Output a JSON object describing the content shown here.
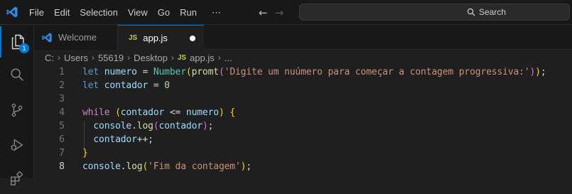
{
  "menu": [
    "File",
    "Edit",
    "Selection",
    "View",
    "Go",
    "Run",
    "⋯"
  ],
  "search": {
    "label": "Search"
  },
  "activity": {
    "explorer_badge": "1"
  },
  "tabs": [
    {
      "label": "Welcome",
      "icon": "vscode-icon"
    },
    {
      "label": "app.js",
      "icon": "JS",
      "dirty": true
    }
  ],
  "breadcrumb": {
    "items": [
      "C:",
      "Users",
      "55619",
      "Desktop"
    ],
    "file_icon": "JS",
    "file": "app.js",
    "symbol": "..."
  },
  "editor": {
    "line_numbers": [
      "1",
      "2",
      "3",
      "4",
      "5",
      "6",
      "7",
      "8"
    ],
    "current_line": 8,
    "lines": [
      [
        [
          "kw",
          "let"
        ],
        [
          "op",
          " "
        ],
        [
          "var",
          "numero"
        ],
        [
          "op",
          " = "
        ],
        [
          "typ",
          "Number"
        ],
        [
          "br1",
          "("
        ],
        [
          "fn",
          "promt"
        ],
        [
          "br2",
          "("
        ],
        [
          "str",
          "'Digite um nuúmero para começar a contagem progressiva:'"
        ],
        [
          "br2",
          ")"
        ],
        [
          "br1",
          ")"
        ],
        [
          "op",
          ";"
        ]
      ],
      [
        [
          "kw",
          "let"
        ],
        [
          "op",
          " "
        ],
        [
          "var",
          "contador"
        ],
        [
          "op",
          " = "
        ],
        [
          "num",
          "0"
        ]
      ],
      [],
      [
        [
          "kwc",
          "while"
        ],
        [
          "op",
          " "
        ],
        [
          "br1",
          "("
        ],
        [
          "var",
          "contador"
        ],
        [
          "op",
          " <= "
        ],
        [
          "var",
          "numero"
        ],
        [
          "br1",
          ")"
        ],
        [
          "op",
          " "
        ],
        [
          "br1",
          "{"
        ]
      ],
      [
        [
          "op",
          "  "
        ],
        [
          "var",
          "console"
        ],
        [
          "op",
          "."
        ],
        [
          "fn",
          "log"
        ],
        [
          "br2",
          "("
        ],
        [
          "var",
          "contador"
        ],
        [
          "br2",
          ")"
        ],
        [
          "op",
          ";"
        ]
      ],
      [
        [
          "op",
          "  "
        ],
        [
          "var",
          "contador"
        ],
        [
          "op",
          "++;"
        ]
      ],
      [
        [
          "br1",
          "}"
        ]
      ],
      [
        [
          "var",
          "console"
        ],
        [
          "op",
          "."
        ],
        [
          "fn",
          "log"
        ],
        [
          "br1",
          "("
        ],
        [
          "str",
          "'Fim da contagem'"
        ],
        [
          "br1",
          ")"
        ],
        [
          "op",
          ";"
        ]
      ]
    ]
  },
  "colors": {
    "accent": "#0078d4",
    "js_icon": "#cbcb41"
  }
}
